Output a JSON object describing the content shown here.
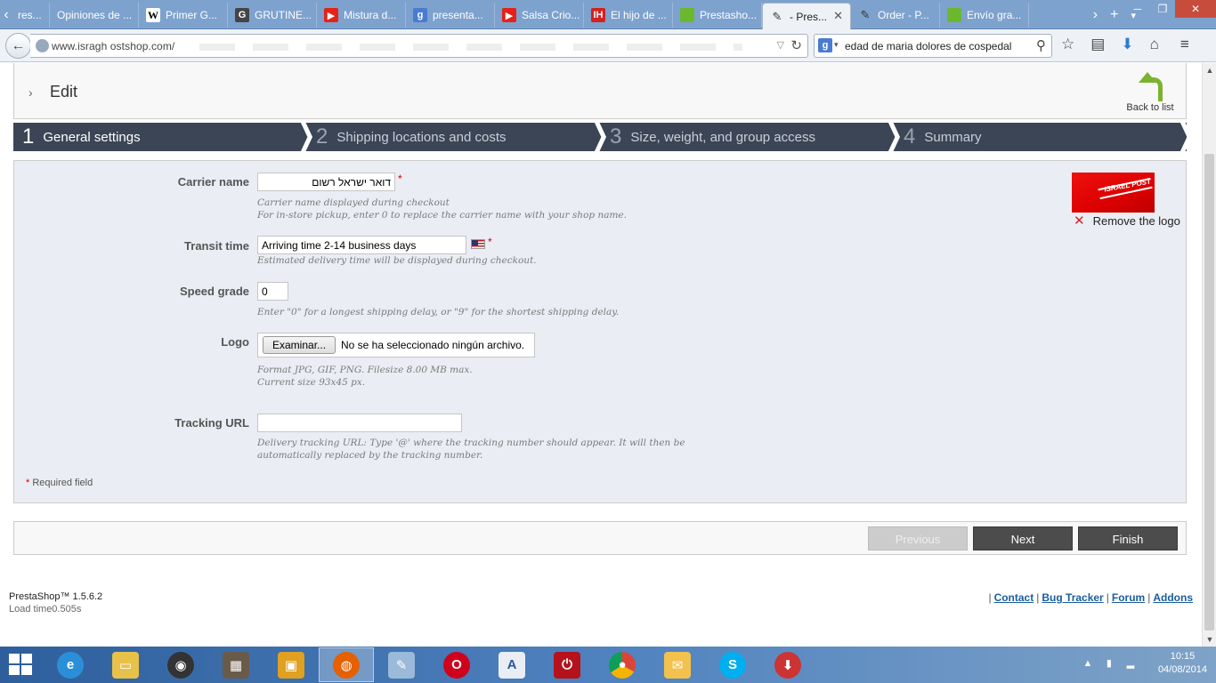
{
  "browser": {
    "tabs": [
      {
        "label": "res...",
        "icon": "back-scroll-icon",
        "first": true
      },
      {
        "label": "Opiniones de ...",
        "icon": "none"
      },
      {
        "label": "Primer G...",
        "icon": "wikipedia-icon",
        "glyph": "W"
      },
      {
        "label": "GRUTINE...",
        "icon": "g-icon",
        "glyph": "G"
      },
      {
        "label": "Mistura d...",
        "icon": "youtube-icon",
        "glyph": "▶"
      },
      {
        "label": "presenta...",
        "icon": "google-plus-icon",
        "glyph": "g"
      },
      {
        "label": "Salsa Crio...",
        "icon": "youtube-icon",
        "glyph": "▶"
      },
      {
        "label": "El hijo de ...",
        "icon": "ih-icon",
        "glyph": "IH"
      },
      {
        "label": "Prestasho...",
        "icon": "prestashop-icon",
        "glyph": ""
      },
      {
        "label": "- Pres...",
        "icon": "edit-icon",
        "glyph": "✎",
        "active": true
      },
      {
        "label": "Order - P...",
        "icon": "edit-icon",
        "glyph": "✎"
      },
      {
        "label": "Envío gra...",
        "icon": "prestashop-icon",
        "glyph": ""
      }
    ],
    "url": "www.isragh ostshop.com/",
    "search_query": "edad de maria dolores de cospedal"
  },
  "header": {
    "title": "Edit",
    "back_to_list": "Back to list"
  },
  "steps": [
    {
      "num": "1",
      "label": "General settings",
      "active": true
    },
    {
      "num": "2",
      "label": "Shipping locations and costs",
      "active": false
    },
    {
      "num": "3",
      "label": "Size, weight, and group access",
      "active": false
    },
    {
      "num": "4",
      "label": "Summary",
      "active": false
    }
  ],
  "form": {
    "carrier_name": {
      "label": "Carrier name",
      "value": "דואר ישראל רשום",
      "hint1": "Carrier name displayed during checkout",
      "hint2": "For in-store pickup, enter 0 to replace the carrier name with your shop name."
    },
    "transit_time": {
      "label": "Transit time",
      "value": "Arriving time 2-14 business days",
      "hint": "Estimated delivery time will be displayed during checkout."
    },
    "speed_grade": {
      "label": "Speed grade",
      "value": "0",
      "hint": "Enter \"0\" for a longest shipping delay, or \"9\" for the shortest shipping delay."
    },
    "logo": {
      "label": "Logo",
      "button": "Examinar...",
      "status": "No se ha seleccionado ningún archivo.",
      "hint1": "Format JPG, GIF, PNG. Filesize 8.00 MB max.",
      "hint2": "Current size 93x45 px.",
      "preview_text": "ISRAEL POST",
      "remove": "Remove the logo"
    },
    "tracking_url": {
      "label": "Tracking URL",
      "value": "",
      "hint1": "Delivery tracking URL: Type '@' where the tracking number should appear. It will then be",
      "hint2": "automatically replaced by the tracking number."
    },
    "required_star": "*",
    "required_note": "Required field"
  },
  "buttons": {
    "previous": "Previous",
    "next": "Next",
    "finish": "Finish"
  },
  "footer": {
    "version": "PrestaShop™ 1.5.6.2",
    "load_time": "Load time0.505s",
    "links": [
      "Contact",
      "Bug Tracker",
      "Forum",
      "Addons"
    ],
    "separator": "|"
  },
  "taskbar": {
    "time": "10:15",
    "date": "04/08/2014"
  }
}
